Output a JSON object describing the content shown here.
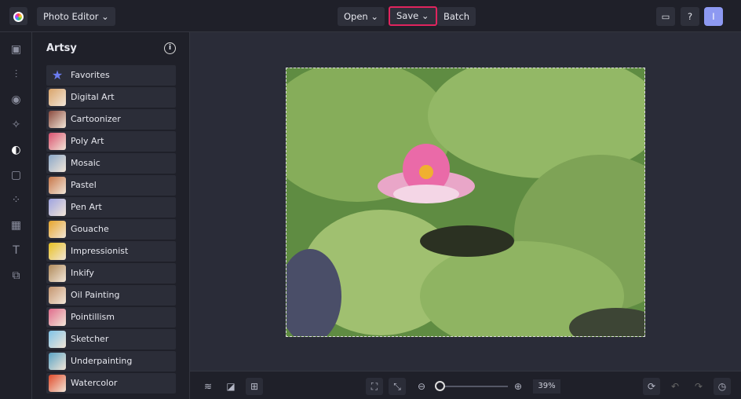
{
  "header": {
    "app_menu": "Photo Editor",
    "open": "Open",
    "save": "Save",
    "batch": "Batch",
    "avatar": "I",
    "accent": "#e0245e"
  },
  "panel": {
    "title": "Artsy",
    "items": [
      {
        "label": "Favorites",
        "thumb": "#6b7cf0"
      },
      {
        "label": "Digital Art",
        "thumb": "#d9a46a"
      },
      {
        "label": "Cartoonizer",
        "thumb": "#8a4a3e"
      },
      {
        "label": "Poly Art",
        "thumb": "#d9506e"
      },
      {
        "label": "Mosaic",
        "thumb": "#8aa7c8"
      },
      {
        "label": "Pastel",
        "thumb": "#c7774a"
      },
      {
        "label": "Pen Art",
        "thumb": "#9ea3e0"
      },
      {
        "label": "Gouache",
        "thumb": "#e7a52a"
      },
      {
        "label": "Impressionist",
        "thumb": "#e8c020"
      },
      {
        "label": "Inkify",
        "thumb": "#b08a5a"
      },
      {
        "label": "Oil Painting",
        "thumb": "#c59670"
      },
      {
        "label": "Pointillism",
        "thumb": "#e06c8c"
      },
      {
        "label": "Sketcher",
        "thumb": "#7fc3e8"
      },
      {
        "label": "Underpainting",
        "thumb": "#5aa3c4"
      },
      {
        "label": "Watercolor",
        "thumb": "#e04a2a"
      }
    ]
  },
  "zoom": {
    "percent": "39%",
    "level": 0.05
  }
}
